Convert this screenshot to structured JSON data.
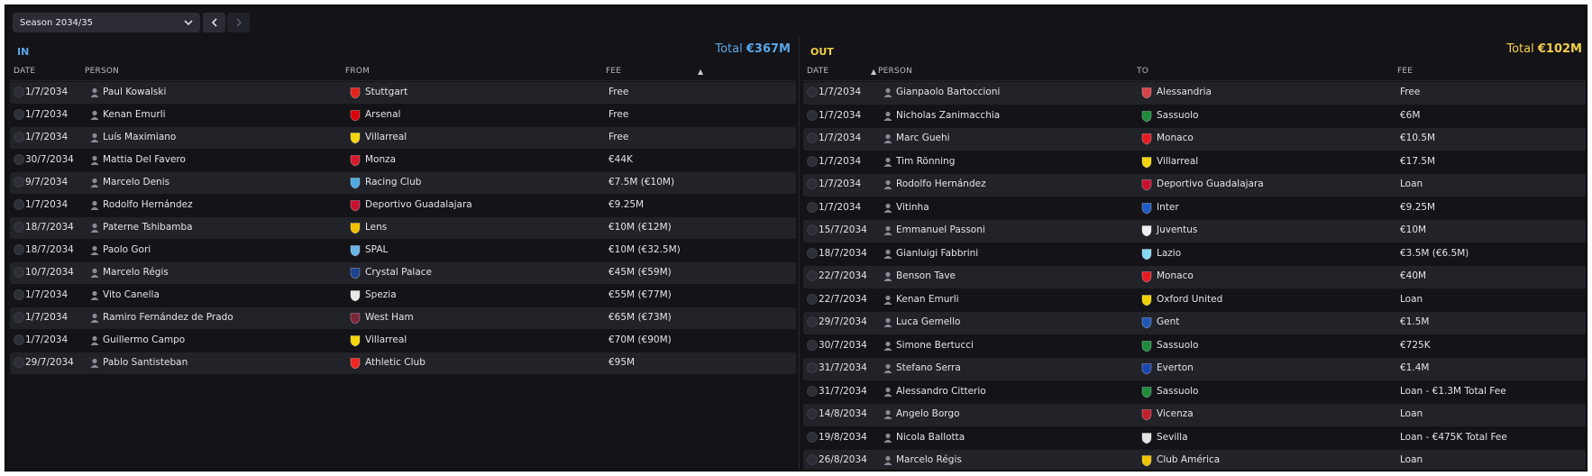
{
  "toolbar": {
    "season_label": "Season 2034/35"
  },
  "in_panel": {
    "title": "IN",
    "total_label": "Total",
    "total_value": "€367M",
    "columns": {
      "date": "DATE",
      "person": "PERSON",
      "from": "FROM",
      "fee": "FEE"
    },
    "rows": [
      {
        "date": "1/7/2034",
        "person": "Paul Kowalski",
        "club": "Stuttgart",
        "fee": "Free",
        "crest_color": "#e32219"
      },
      {
        "date": "1/7/2034",
        "person": "Kenan Emurli",
        "club": "Arsenal",
        "fee": "Free",
        "crest_color": "#db0007"
      },
      {
        "date": "1/7/2034",
        "person": "Luís Maximiano",
        "club": "Villarreal",
        "fee": "Free",
        "crest_color": "#f5d50a"
      },
      {
        "date": "30/7/2034",
        "person": "Mattia Del Favero",
        "club": "Monza",
        "fee": "€44K",
        "crest_color": "#d7192c"
      },
      {
        "date": "9/7/2034",
        "person": "Marcelo Denis",
        "club": "Racing Club",
        "fee": "€7.5M (€10M)",
        "crest_color": "#4fa8e0"
      },
      {
        "date": "1/7/2034",
        "person": "Rodolfo Hernández",
        "club": "Deportivo Guadalajara",
        "fee": "€9.25M",
        "crest_color": "#c8102e"
      },
      {
        "date": "18/7/2034",
        "person": "Paterne Tshibamba",
        "club": "Lens",
        "fee": "€10M (€12M)",
        "crest_color": "#f5c000"
      },
      {
        "date": "18/7/2034",
        "person": "Paolo Gori",
        "club": "SPAL",
        "fee": "€10M (€32.5M)",
        "crest_color": "#69b3e7"
      },
      {
        "date": "10/7/2034",
        "person": "Marcelo Régis",
        "club": "Crystal Palace",
        "fee": "€45M (€59M)",
        "crest_color": "#1b458f"
      },
      {
        "date": "1/7/2034",
        "person": "Vito Canella",
        "club": "Spezia",
        "fee": "€55M (€77M)",
        "crest_color": "#e8e8e8"
      },
      {
        "date": "1/7/2034",
        "person": "Ramiro Fernández de Prado",
        "club": "West Ham",
        "fee": "€65M (€73M)",
        "crest_color": "#7a263a"
      },
      {
        "date": "1/7/2034",
        "person": "Guillermo Campo",
        "club": "Villarreal",
        "fee": "€70M (€90M)",
        "crest_color": "#f5d50a"
      },
      {
        "date": "29/7/2034",
        "person": "Pablo Santisteban",
        "club": "Athletic Club",
        "fee": "€95M",
        "crest_color": "#ee2523"
      }
    ]
  },
  "out_panel": {
    "title": "OUT",
    "total_label": "Total",
    "total_value": "€102M",
    "columns": {
      "date": "DATE",
      "person": "PERSON",
      "to": "TO",
      "fee": "FEE"
    },
    "rows": [
      {
        "date": "1/7/2034",
        "person": "Gianpaolo Bartoccioni",
        "club": "Alessandria",
        "fee": "Free",
        "crest_color": "#d9434a"
      },
      {
        "date": "1/7/2034",
        "person": "Nicholas Zanimacchia",
        "club": "Sassuolo",
        "fee": "€6M",
        "crest_color": "#1e8a3c"
      },
      {
        "date": "1/7/2034",
        "person": "Marc Guehi",
        "club": "Monaco",
        "fee": "€10.5M",
        "crest_color": "#e51b22"
      },
      {
        "date": "1/7/2034",
        "person": "Tim Rönning",
        "club": "Villarreal",
        "fee": "€17.5M",
        "crest_color": "#f5d50a"
      },
      {
        "date": "1/7/2034",
        "person": "Rodolfo Hernández",
        "club": "Deportivo Guadalajara",
        "fee": "Loan",
        "crest_color": "#c8102e"
      },
      {
        "date": "1/7/2034",
        "person": "Vitinha",
        "club": "Inter",
        "fee": "€9.25M",
        "crest_color": "#1e5bc6"
      },
      {
        "date": "15/7/2034",
        "person": "Emmanuel Passoni",
        "club": "Juventus",
        "fee": "€10M",
        "crest_color": "#f0f0f0"
      },
      {
        "date": "18/7/2034",
        "person": "Gianluigi Fabbrini",
        "club": "Lazio",
        "fee": "€3.5M (€6.5M)",
        "crest_color": "#87d8f7"
      },
      {
        "date": "22/7/2034",
        "person": "Benson Tave",
        "club": "Monaco",
        "fee": "€40M",
        "crest_color": "#e51b22"
      },
      {
        "date": "22/7/2034",
        "person": "Kenan Emurli",
        "club": "Oxford United",
        "fee": "Loan",
        "crest_color": "#f2d100"
      },
      {
        "date": "29/7/2034",
        "person": "Luca Gemello",
        "club": "Gent",
        "fee": "€1.5M",
        "crest_color": "#1f57b5"
      },
      {
        "date": "30/7/2034",
        "person": "Simone Bertucci",
        "club": "Sassuolo",
        "fee": "€725K",
        "crest_color": "#1e8a3c"
      },
      {
        "date": "31/7/2034",
        "person": "Stefano Serra",
        "club": "Everton",
        "fee": "€1.4M",
        "crest_color": "#1948b0"
      },
      {
        "date": "31/7/2034",
        "person": "Alessandro Citterio",
        "club": "Sassuolo",
        "fee": "Loan - €1.3M Total Fee",
        "crest_color": "#1e8a3c"
      },
      {
        "date": "14/8/2034",
        "person": "Angelo Borgo",
        "club": "Vicenza",
        "fee": "Loan",
        "crest_color": "#c21f2a"
      },
      {
        "date": "19/8/2034",
        "person": "Nicola Ballotta",
        "club": "Sevilla",
        "fee": "Loan - €475K Total Fee",
        "crest_color": "#e4e4e4"
      },
      {
        "date": "26/8/2034",
        "person": "Marcelo Régis",
        "club": "Club América",
        "fee": "Loan",
        "crest_color": "#f0c400"
      }
    ]
  }
}
